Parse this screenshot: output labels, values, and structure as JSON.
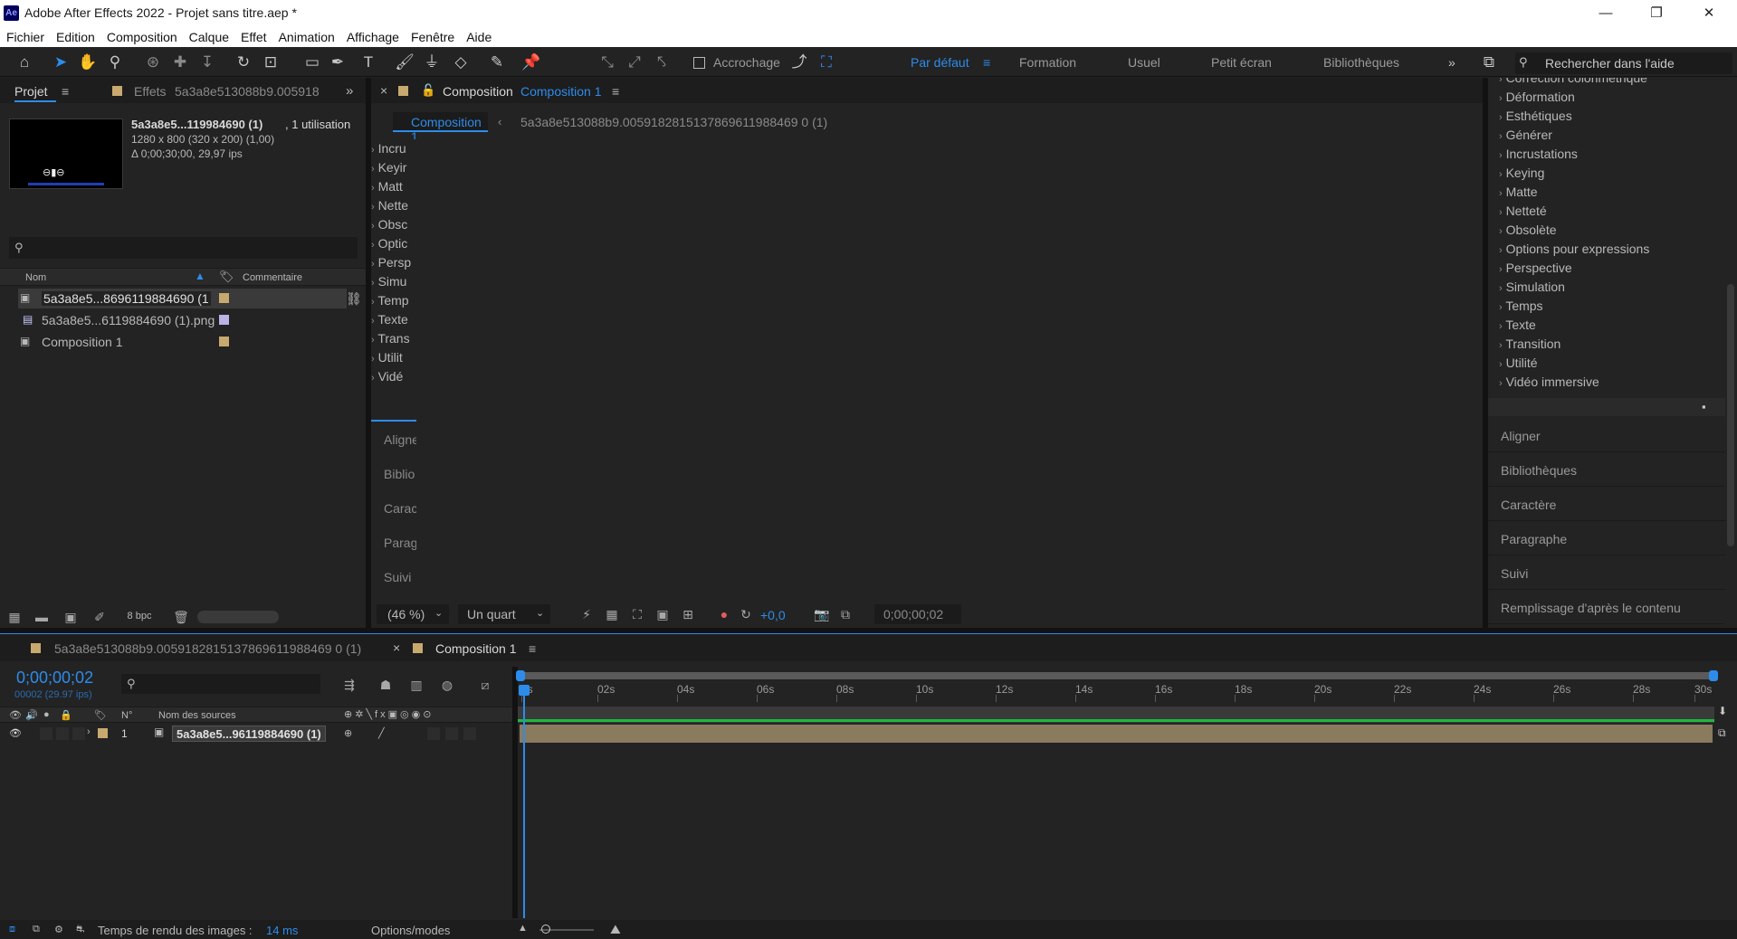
{
  "window": {
    "app_icon": "Ae",
    "title": "Adobe After Effects 2022 - Projet sans titre.aep *",
    "minimize_glyph": "—",
    "maximize_glyph": "❐",
    "close_glyph": "✕"
  },
  "menu": [
    "Fichier",
    "Edition",
    "Composition",
    "Calque",
    "Effet",
    "Animation",
    "Affichage",
    "Fenêtre",
    "Aide"
  ],
  "toolbar": {
    "snapping_label": "Accrochage",
    "workspaces": [
      "Par défaut",
      "Formation",
      "Usuel",
      "Petit écran",
      "Bibliothèques"
    ],
    "active_workspace": "Par défaut",
    "help_search_placeholder": "Rechercher dans l'aide"
  },
  "project_panel": {
    "tab_label": "Projet",
    "effects_tab_label": "Effets",
    "effects_tab_name": "5a3a8e513088b9.005918",
    "selected_item": {
      "name": "5a3a8e5...119984690 (1)",
      "usage": ", 1 utilisation",
      "dimensions": "1280 x 800  (320 x 200) (1,00)",
      "duration": "Δ 0;00;30;00, 29,97 ips"
    },
    "search_placeholder": "",
    "columns": {
      "name": "Nom",
      "comment": "Commentaire"
    },
    "items": [
      {
        "name": "5a3a8e5...8696119884690 (1",
        "type": "composition",
        "label_color": "#c8a96e"
      },
      {
        "name": "5a3a8e5...6119884690 (1).png",
        "type": "image",
        "label_color": "#b9b4e6"
      },
      {
        "name": "Composition 1",
        "type": "composition",
        "label_color": "#c8a96e"
      }
    ],
    "bpc": "8 bpc"
  },
  "comp_panel": {
    "tab_prefix": "Composition",
    "tab_name": "Composition 1",
    "breadcrumb_active": "Composition 1",
    "breadcrumb_next": "5a3a8e513088b9.0059182815137869611988469 0 (1)",
    "truncated_effects": [
      "Incru",
      "Keyir",
      "Matt",
      "Nette",
      "Obsc",
      "Optic",
      "Persp",
      "Simu",
      "Temp",
      "Texte",
      "Trans",
      "Utilit",
      "Vidé"
    ],
    "truncated_tabs": [
      "Aligne",
      "Biblio",
      "Carac",
      "Parag",
      "Suivi"
    ],
    "zoom": "(46 %)",
    "resolution": "Un quart",
    "exposure": "+0,0",
    "current_time": "0;00;00;02"
  },
  "effects_panel": {
    "items": [
      "Correction colorimétrique",
      "Déformation",
      "Esthétiques",
      "Générer",
      "Incrustations",
      "Keying",
      "Matte",
      "Netteté",
      "Obsolète",
      "Options pour expressions",
      "Perspective",
      "Simulation",
      "Temps",
      "Texte",
      "Transition",
      "Utilité",
      "Vidéo immersive"
    ],
    "tabs": [
      "Aligner",
      "Bibliothèques",
      "Caractère",
      "Paragraphe",
      "Suivi",
      "Remplissage d'après le contenu"
    ]
  },
  "timeline": {
    "tab1": "5a3a8e513088b9.0059182815137869611988469 0 (1)",
    "tab2": "Composition 1",
    "timecode": "0;00;00;02",
    "frame_info": "00002 (29.97 ips)",
    "columns": {
      "number": "N°",
      "source_name": "Nom des sources"
    },
    "ruler": [
      "0s",
      "02s",
      "04s",
      "06s",
      "08s",
      "10s",
      "12s",
      "14s",
      "16s",
      "18s",
      "20s",
      "22s",
      "24s",
      "26s",
      "28s",
      "30s"
    ],
    "layers": [
      {
        "index": "1",
        "name": "5a3a8e5...96119884690 (1)"
      }
    ],
    "render_label": "Temps de rendu des images :",
    "render_value": "14 ms",
    "options_modes": "Options/modes"
  },
  "colors": {
    "accent": "#2d8ceb",
    "layer_bar": "#8a7a5e",
    "work_area": "#1fb83c",
    "label_tan": "#c8a96e",
    "label_lavender": "#b9b4e6"
  }
}
